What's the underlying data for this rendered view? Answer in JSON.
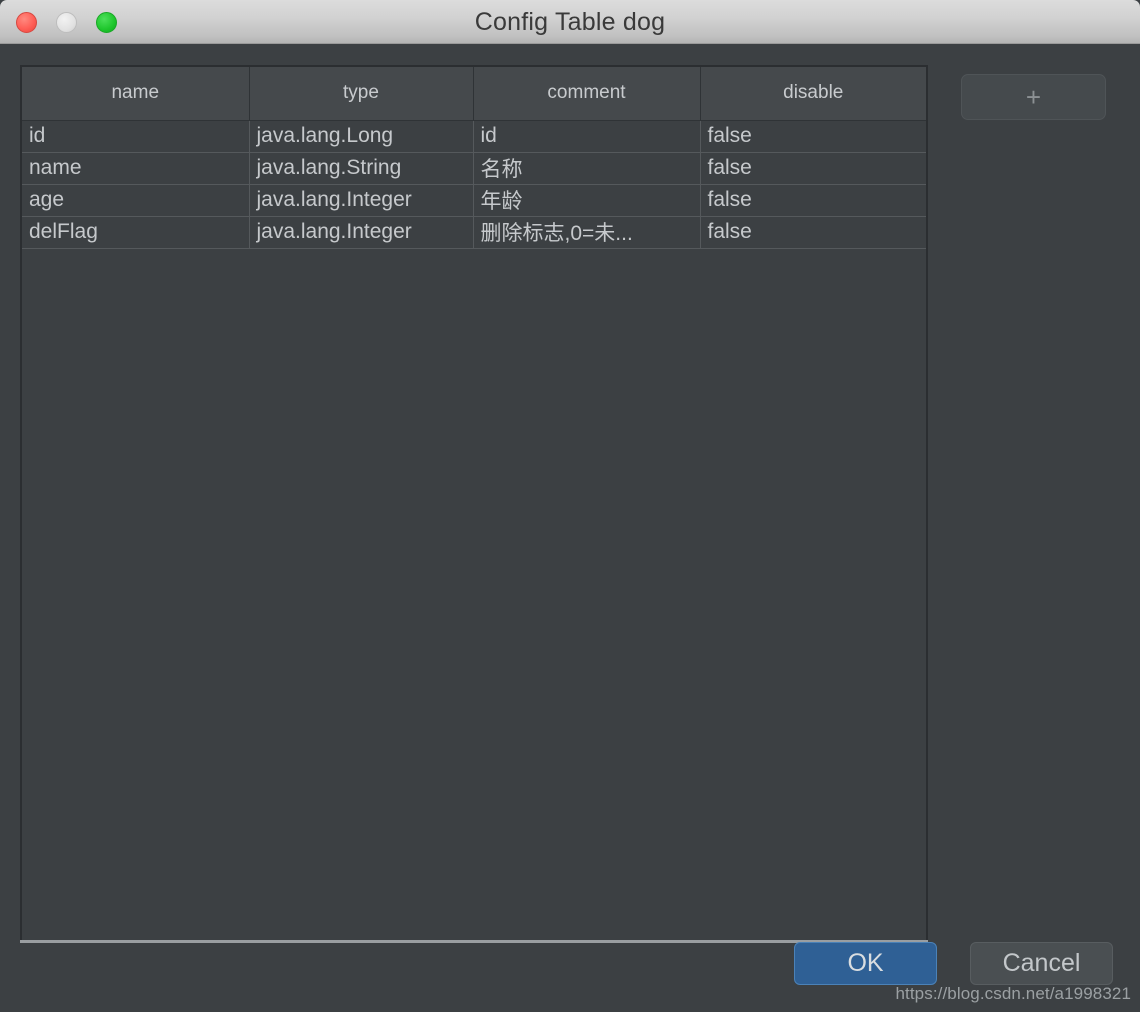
{
  "window": {
    "title": "Config Table dog",
    "traffic_lights": [
      {
        "name": "close",
        "color": "#ff5f57"
      },
      {
        "name": "minimize",
        "color": "#e2e2e2"
      },
      {
        "name": "zoom",
        "color": "#1ec62c"
      }
    ],
    "background_color": "#3c4043"
  },
  "table": {
    "columns": [
      "name",
      "type",
      "comment",
      "disable"
    ],
    "rows": [
      {
        "name": "id",
        "type": "java.lang.Long",
        "comment": "id",
        "disable": "false"
      },
      {
        "name": "name",
        "type": "java.lang.String",
        "comment": "名称",
        "disable": "false"
      },
      {
        "name": "age",
        "type": "java.lang.Integer",
        "comment": "年龄",
        "disable": "false"
      },
      {
        "name": "delFlag",
        "type": "java.lang.Integer",
        "comment": "删除标志,0=未...",
        "disable": "false"
      }
    ]
  },
  "sidebar": {
    "add_label": "+"
  },
  "footer": {
    "ok_label": "OK",
    "cancel_label": "Cancel",
    "accent_color": "#2f6095"
  },
  "watermark": {
    "text": "https://blog.csdn.net/a1998321"
  }
}
